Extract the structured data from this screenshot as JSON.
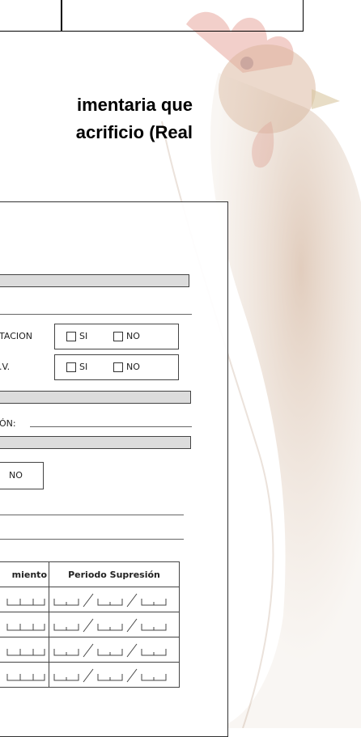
{
  "heading": {
    "line1": "imentaria que",
    "line2": "acrificio (Real"
  },
  "form": {
    "row_label_1": "TACION",
    "row_label_2": ".V.",
    "opt_si": "SI",
    "opt_no": "NO",
    "field_label": "ÓN:",
    "standalone_no": "NO",
    "col_header_1": "miento",
    "col_header_2": "Periodo Supresión",
    "rows": 4
  },
  "colors": {
    "watermark_comb": "#e08a80",
    "watermark_body": "#b58d70"
  }
}
